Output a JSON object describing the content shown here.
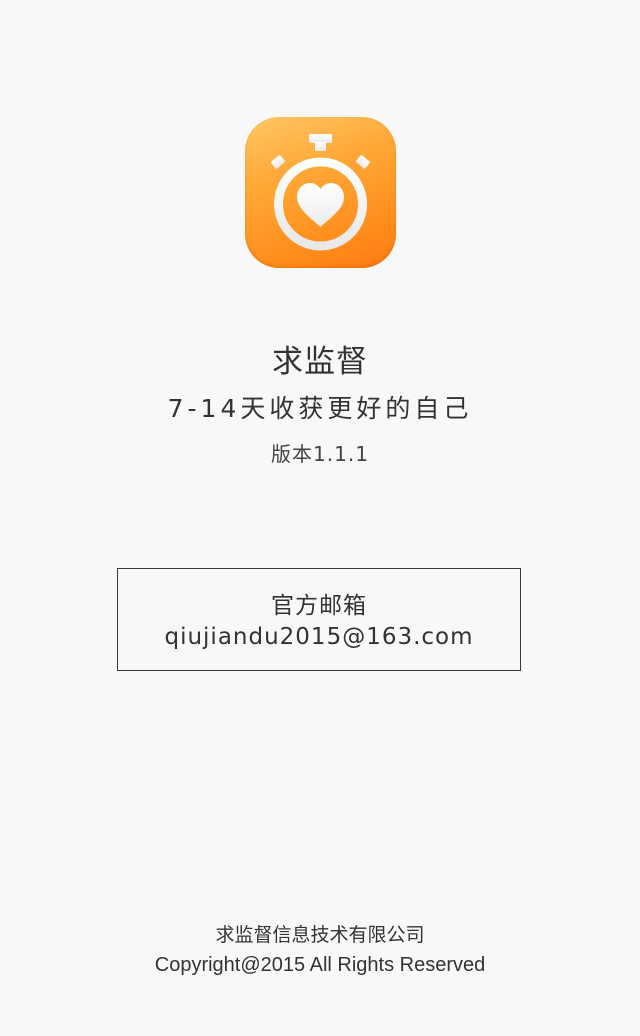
{
  "app": {
    "name": "求监督",
    "slogan": "7-14天收获更好的自己",
    "version": "版本1.1.1",
    "icon": "stopwatch-heart-icon",
    "icon_colors": [
      "#ffc766",
      "#ff8e1c",
      "#ff7a12"
    ]
  },
  "contact": {
    "title": "官方邮箱",
    "email": "qiujiandu2015@163.com"
  },
  "footer": {
    "company": "求监督信息技术有限公司",
    "copyright": "Copyright@2015 All Rights Reserved"
  }
}
